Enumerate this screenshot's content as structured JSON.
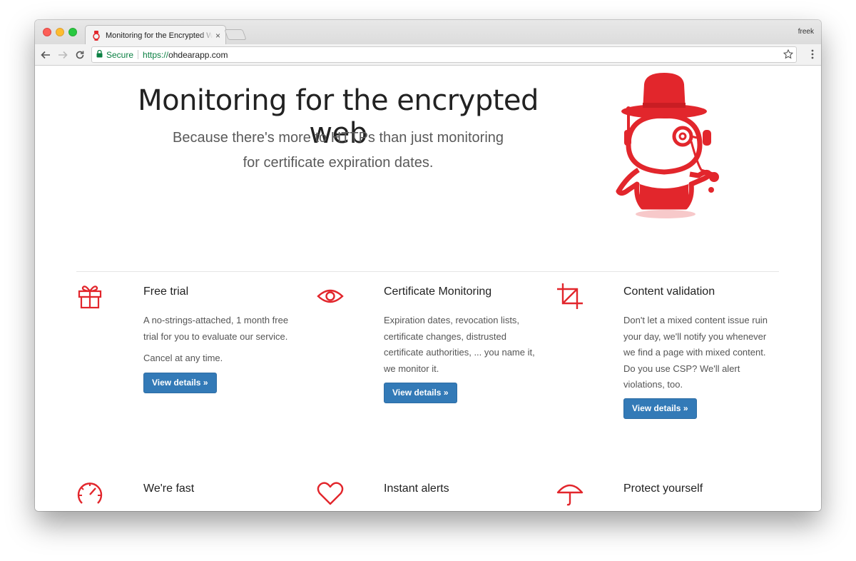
{
  "browser": {
    "tab_title": "Monitoring for the Encrypted Web",
    "tab_close": "×",
    "profile_name": "freek",
    "security_label": "Secure",
    "url_scheme": "https://",
    "url_host": "ohdearapp.com"
  },
  "hero": {
    "title": "Monitoring for the encrypted web",
    "subtitle_line1": "Because there's more to HTTPs than just monitoring",
    "subtitle_line2": "for certificate expiration dates."
  },
  "colors": {
    "brand_red": "#e2262c",
    "button_blue": "#337ab7"
  },
  "features": [
    {
      "icon": "gift-icon",
      "title": "Free trial",
      "text1": "A no-strings-attached, 1 month free trial for you to evaluate our service.",
      "text2": "Cancel at any time.",
      "button": "View details »"
    },
    {
      "icon": "eye-icon",
      "title": "Certificate Monitoring",
      "text1": "Expiration dates, revocation lists, certificate changes, distrusted certificate authorities, ... you name it, we monitor it.",
      "button": "View details »"
    },
    {
      "icon": "crop-icon",
      "title": "Content validation",
      "text1": "Don't let a mixed content issue ruin your day, we'll notify you whenever we find a page with mixed content. Do you use CSP? We'll alert violations, too.",
      "button": "View details »"
    },
    {
      "icon": "speedometer-icon",
      "title": "We're fast"
    },
    {
      "icon": "heart-icon",
      "title": "Instant alerts"
    },
    {
      "icon": "umbrella-icon",
      "title": "Protect yourself"
    }
  ]
}
